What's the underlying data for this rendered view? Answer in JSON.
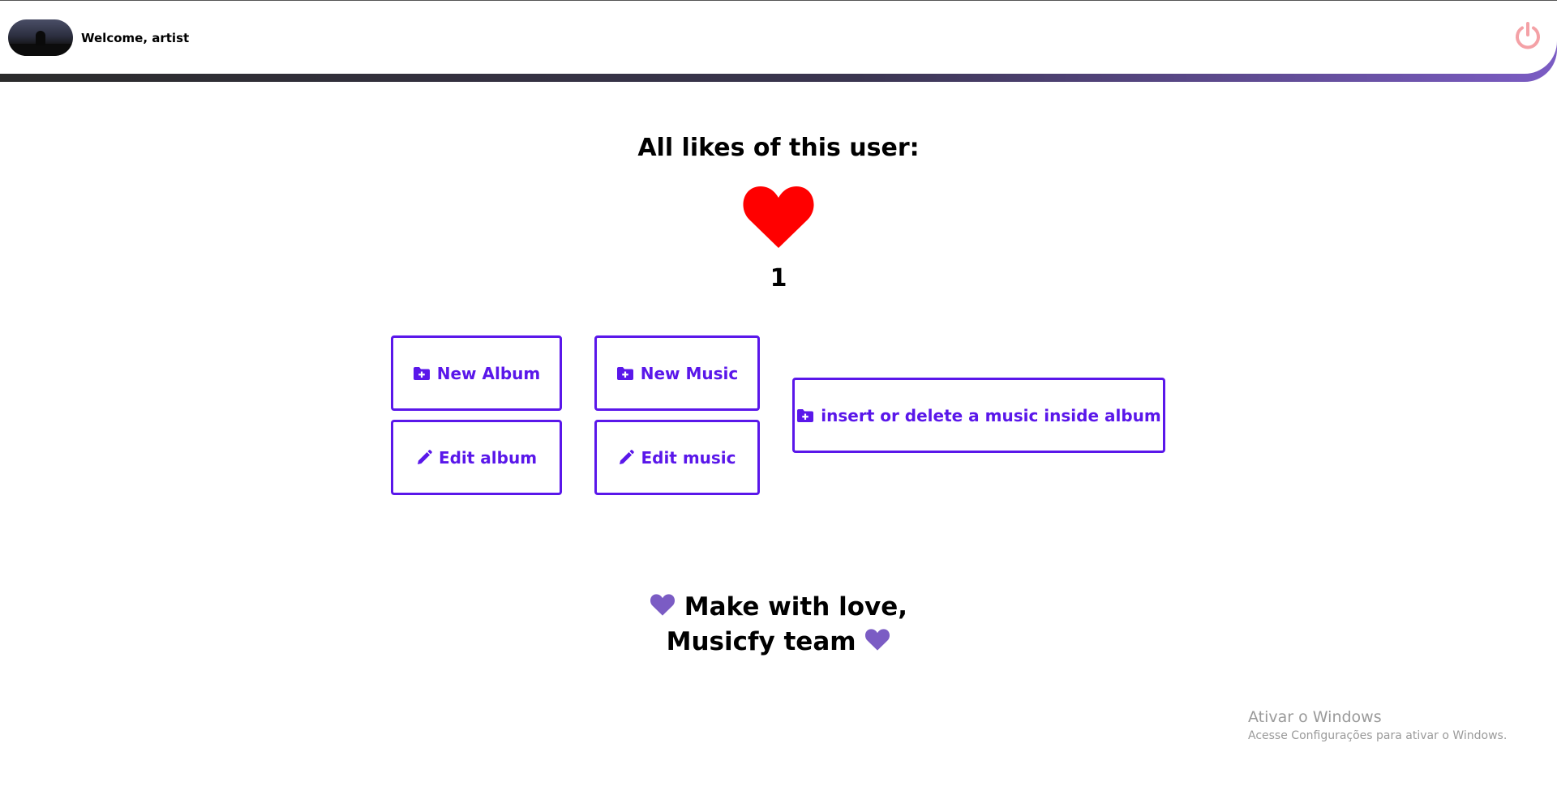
{
  "header": {
    "welcome_text": "Welcome, artist"
  },
  "main": {
    "title": "All likes of this user:",
    "likes_count": "1"
  },
  "actions": {
    "new_album": "New Album",
    "new_music": "New Music",
    "edit_album": "Edit album",
    "edit_music": "Edit music",
    "insert_delete": "insert or delete a music inside album"
  },
  "footer": {
    "line1": "Make with love,",
    "line2": "Musicfy team"
  },
  "os_watermark": {
    "title": "Ativar o Windows",
    "subtitle": "Acesse Configurações para ativar o Windows."
  },
  "colors": {
    "accent": "#5a17ea",
    "heart_big": "#ff0000",
    "heart_small": "#7b5cc4",
    "power_icon": "#f4a1a6"
  },
  "icons": {
    "avatar": "profile-photo",
    "logout": "power-icon",
    "like": "heart-icon",
    "new": "folder-plus-icon",
    "edit": "pencil-icon"
  }
}
